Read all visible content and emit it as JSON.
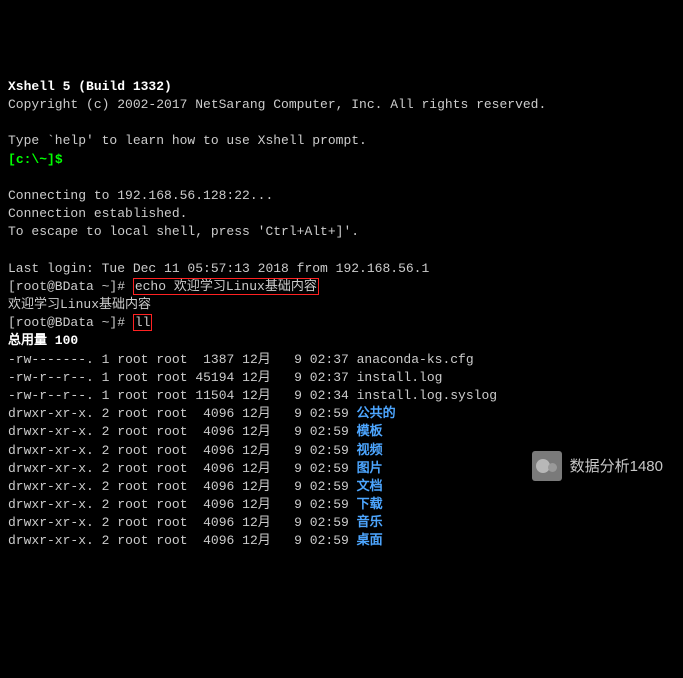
{
  "header": {
    "title": "Xshell 5 (Build 1332)",
    "copyright": "Copyright (c) 2002-2017 NetSarang Computer, Inc. All rights reserved.",
    "help_hint": "Type `help' to learn how to use Xshell prompt.",
    "local_prompt_open": "[",
    "local_prompt_path": "c:\\~",
    "local_prompt_close": "]$ ",
    "connecting": "Connecting to 192.168.56.128:22...",
    "established": "Connection established.",
    "escape_hint": "To escape to local shell, press 'Ctrl+Alt+]'.",
    "last_login": "Last login: Tue Dec 11 05:57:13 2018 from 192.168.56.1"
  },
  "session": {
    "prompt1": "[root@BData ~]# ",
    "cmd1": "echo 欢迎学习Linux基础内容",
    "output1": "欢迎学习Linux基础内容",
    "prompt2": "[root@BData ~]# ",
    "cmd2": "ll",
    "total": "总用量 100"
  },
  "listing": [
    {
      "perms": "-rw-------.",
      "links": "1",
      "owner": "root",
      "group": "root",
      "size": " 1387",
      "month": "12月",
      "day": " 9",
      "time": "02:37",
      "name": "anaconda-ks.cfg",
      "type": "file"
    },
    {
      "perms": "-rw-r--r--.",
      "links": "1",
      "owner": "root",
      "group": "root",
      "size": "45194",
      "month": "12月",
      "day": " 9",
      "time": "02:37",
      "name": "install.log",
      "type": "file"
    },
    {
      "perms": "-rw-r--r--.",
      "links": "1",
      "owner": "root",
      "group": "root",
      "size": "11504",
      "month": "12月",
      "day": " 9",
      "time": "02:34",
      "name": "install.log.syslog",
      "type": "file"
    },
    {
      "perms": "drwxr-xr-x.",
      "links": "2",
      "owner": "root",
      "group": "root",
      "size": " 4096",
      "month": "12月",
      "day": " 9",
      "time": "02:59",
      "name": "公共的",
      "type": "dir"
    },
    {
      "perms": "drwxr-xr-x.",
      "links": "2",
      "owner": "root",
      "group": "root",
      "size": " 4096",
      "month": "12月",
      "day": " 9",
      "time": "02:59",
      "name": "模板",
      "type": "dir"
    },
    {
      "perms": "drwxr-xr-x.",
      "links": "2",
      "owner": "root",
      "group": "root",
      "size": " 4096",
      "month": "12月",
      "day": " 9",
      "time": "02:59",
      "name": "视频",
      "type": "dir"
    },
    {
      "perms": "drwxr-xr-x.",
      "links": "2",
      "owner": "root",
      "group": "root",
      "size": " 4096",
      "month": "12月",
      "day": " 9",
      "time": "02:59",
      "name": "图片",
      "type": "dir"
    },
    {
      "perms": "drwxr-xr-x.",
      "links": "2",
      "owner": "root",
      "group": "root",
      "size": " 4096",
      "month": "12月",
      "day": " 9",
      "time": "02:59",
      "name": "文档",
      "type": "dir"
    },
    {
      "perms": "drwxr-xr-x.",
      "links": "2",
      "owner": "root",
      "group": "root",
      "size": " 4096",
      "month": "12月",
      "day": " 9",
      "time": "02:59",
      "name": "下载",
      "type": "dir"
    },
    {
      "perms": "drwxr-xr-x.",
      "links": "2",
      "owner": "root",
      "group": "root",
      "size": " 4096",
      "month": "12月",
      "day": " 9",
      "time": "02:59",
      "name": "音乐",
      "type": "dir"
    },
    {
      "perms": "drwxr-xr-x.",
      "links": "2",
      "owner": "root",
      "group": "root",
      "size": " 4096",
      "month": "12月",
      "day": " 9",
      "time": "02:59",
      "name": "桌面",
      "type": "dir"
    }
  ],
  "watermark": {
    "text": "数据分析1480"
  }
}
